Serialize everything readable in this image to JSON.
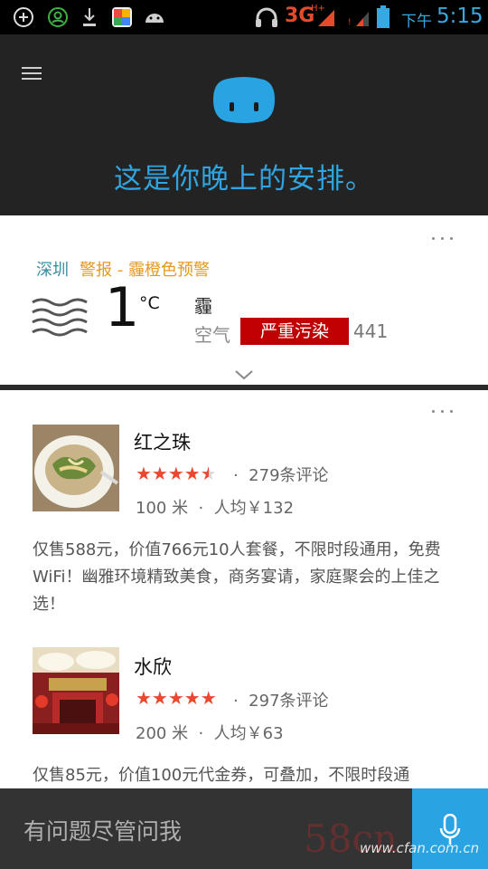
{
  "status_bar": {
    "network": "3G",
    "network_sup": "H+",
    "ampm": "下午",
    "time": "5:15",
    "accent": "#37a9e0"
  },
  "header": {
    "greeting": "这是你晚上的安排。",
    "accent": "#2fa4e0"
  },
  "weather_card": {
    "city": "深圳",
    "alert": "警报 - 霾橙色预警",
    "temperature": "1",
    "unit": "°C",
    "condition": "霾",
    "air_quality_label": "空气",
    "air_quality_level": "严重污染",
    "air_quality_value": "441",
    "badge_color": "#c00000"
  },
  "restaurants": [
    {
      "name": "红之珠",
      "rating": 4.5,
      "stars_display": "★★★★",
      "stars_half": "★",
      "reviews": "279条评论",
      "distance": "100 米",
      "avg_price": "人均￥132",
      "description": "仅售588元，价值766元10人套餐，不限时段通用，免费WiFi！幽雅环境精致美食，商务宴请，家庭聚会的上佳之选！"
    },
    {
      "name": "水欣",
      "rating": 5,
      "stars_display": "★★★★★",
      "reviews": "297条评论",
      "distance": "200 米",
      "avg_price": "人均￥63",
      "description": "仅售85元，价值100元代金券，可叠加，不限时段通"
    }
  ],
  "bottom_bar": {
    "ask_prompt": "有问题尽管问我"
  },
  "watermark": {
    "logo_text": "58cn",
    "site": "www.cfan.com.cn"
  }
}
